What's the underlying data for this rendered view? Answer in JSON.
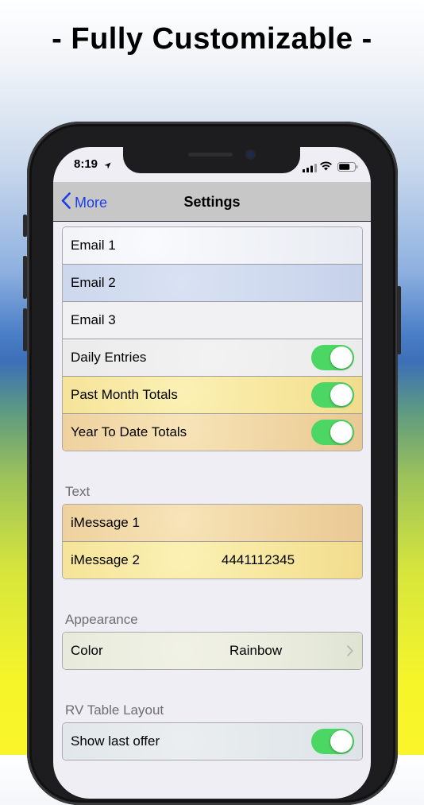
{
  "headline": "- Fully Customizable -",
  "status_bar": {
    "time": "8:19"
  },
  "navbar": {
    "back_label": "More",
    "title": "Settings"
  },
  "email_group": {
    "rows": [
      {
        "label": "Email 1"
      },
      {
        "label": "Email 2"
      },
      {
        "label": "Email 3"
      },
      {
        "label": "Daily Entries",
        "toggle": true
      },
      {
        "label": "Past Month Totals",
        "toggle": true
      },
      {
        "label": "Year To Date Totals",
        "toggle": true
      }
    ]
  },
  "text_section": {
    "header": "Text",
    "rows": [
      {
        "label": "iMessage 1",
        "value": ""
      },
      {
        "label": "iMessage 2",
        "value": "4441112345"
      }
    ]
  },
  "appearance_section": {
    "header": "Appearance",
    "rows": [
      {
        "label": "Color",
        "value": "Rainbow"
      }
    ]
  },
  "rv_section": {
    "header": "RV Table Layout",
    "rows": [
      {
        "label": "Show last offer",
        "toggle": true
      }
    ]
  },
  "colors": {
    "accent": "#1a3fe8",
    "toggle_on": "#4cd663",
    "nav_bar": "#c7c7c7"
  }
}
